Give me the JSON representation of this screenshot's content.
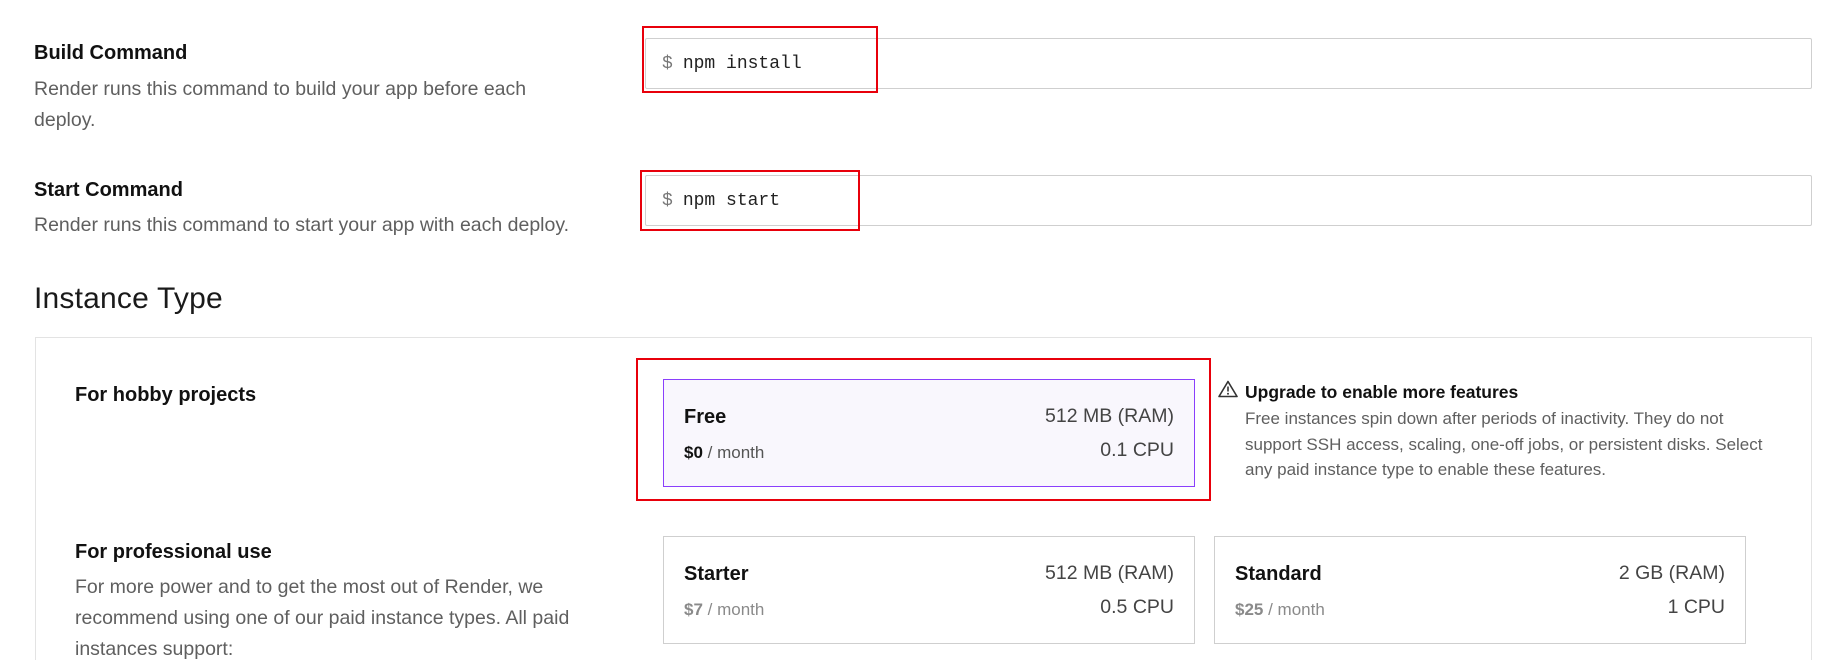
{
  "build": {
    "title": "Build Command",
    "desc_line1": "Render runs this command to build your app before each",
    "desc_line2": "deploy.",
    "prefix": "$",
    "value": "npm install"
  },
  "start": {
    "title": "Start Command",
    "desc": "Render runs this command to start your app with each deploy.",
    "prefix": "$",
    "value": "npm start"
  },
  "instance": {
    "section_title": "Instance Type",
    "hobby": {
      "title": "For hobby projects",
      "card": {
        "name": "Free",
        "ram": "512 MB (RAM)",
        "price": "$0",
        "period": "/ month",
        "cpu": "0.1 CPU"
      },
      "warning": {
        "icon": "warning-triangle-icon",
        "title": "Upgrade to enable more features",
        "text": "Free instances spin down after periods of inactivity. They do not support SSH access, scaling, one-off jobs, or persistent disks. Select any paid instance type to enable these features."
      }
    },
    "pro": {
      "title": "For professional use",
      "desc_line1": "For more power and to get the most out of Render, we",
      "desc_line2": "recommend using one of our paid instance types. All paid",
      "desc_line3": "instances support:",
      "cards": [
        {
          "name": "Starter",
          "ram": "512 MB (RAM)",
          "price": "$7",
          "period": "/ month",
          "cpu": "0.5 CPU"
        },
        {
          "name": "Standard",
          "ram": "2 GB (RAM)",
          "price": "$25",
          "period": "/ month",
          "cpu": "1 CPU"
        }
      ]
    }
  },
  "colors": {
    "highlight": "#e8000b",
    "selected_border": "#8a3ffc",
    "selected_bg": "#f9f7fd"
  }
}
